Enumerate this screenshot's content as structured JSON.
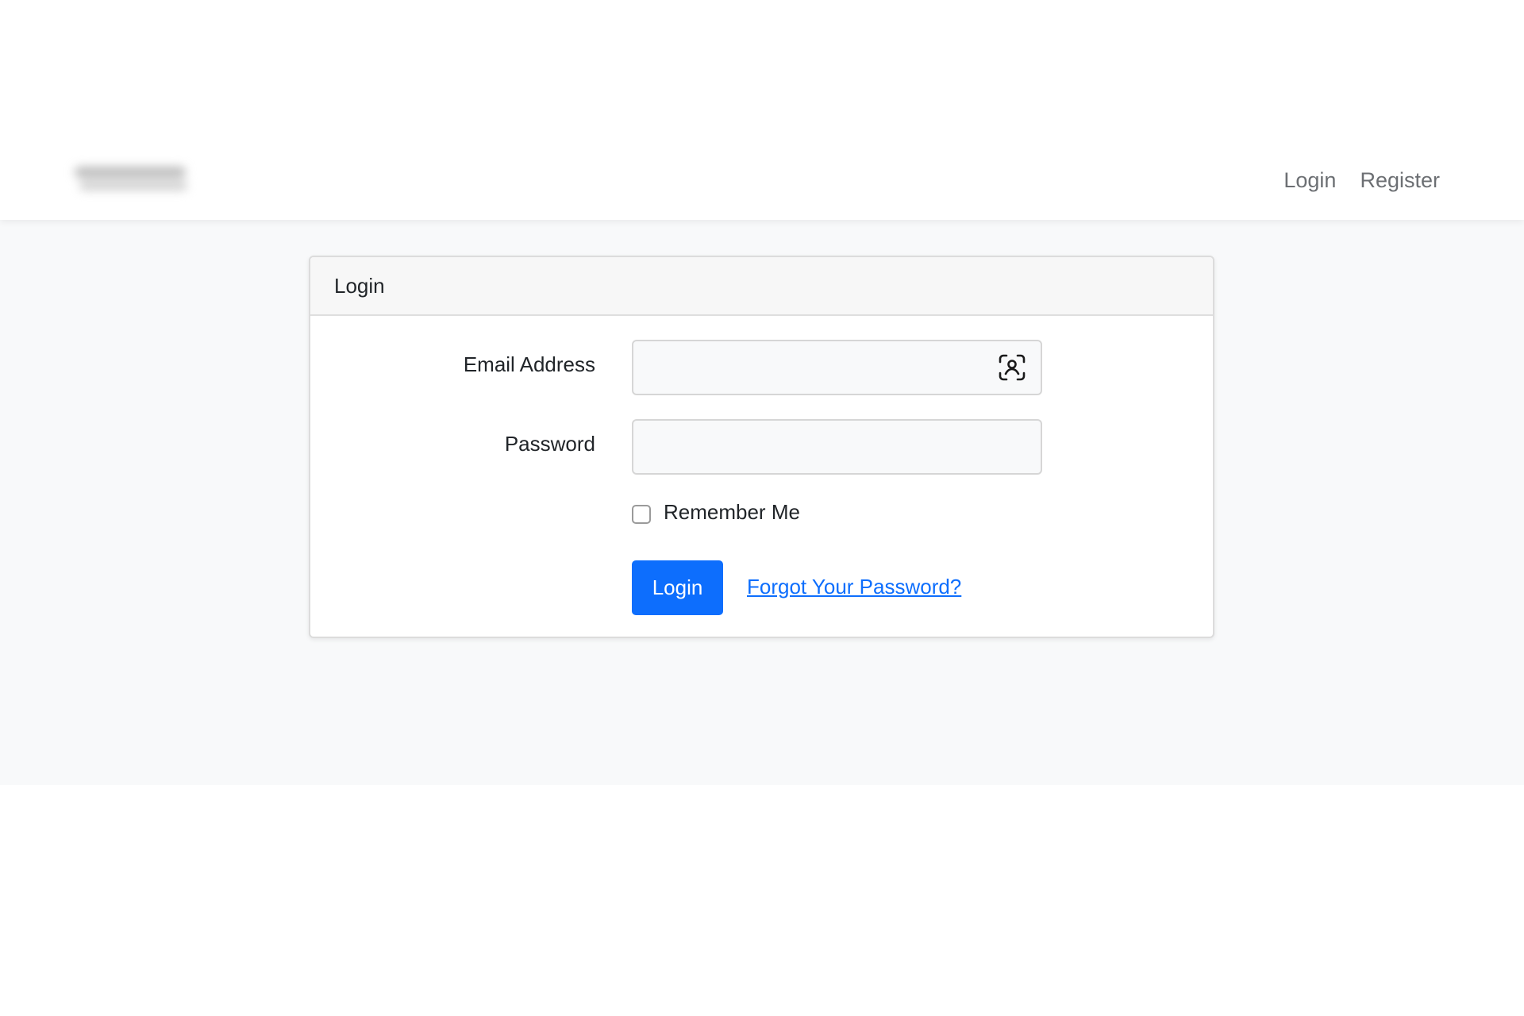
{
  "nav": {
    "links": [
      {
        "label": "Login"
      },
      {
        "label": "Register"
      }
    ]
  },
  "card": {
    "header": "Login"
  },
  "form": {
    "email_label": "Email Address",
    "email_value": "",
    "email_icon": "face-scan-icon",
    "password_label": "Password",
    "password_value": "",
    "remember_label": "Remember Me",
    "remember_checked": false,
    "submit_label": "Login",
    "forgot_label": "Forgot Your Password?"
  },
  "colors": {
    "primary": "#0d6efd",
    "nav_link": "#6c6f73",
    "page_bg": "#f8f9fa"
  }
}
